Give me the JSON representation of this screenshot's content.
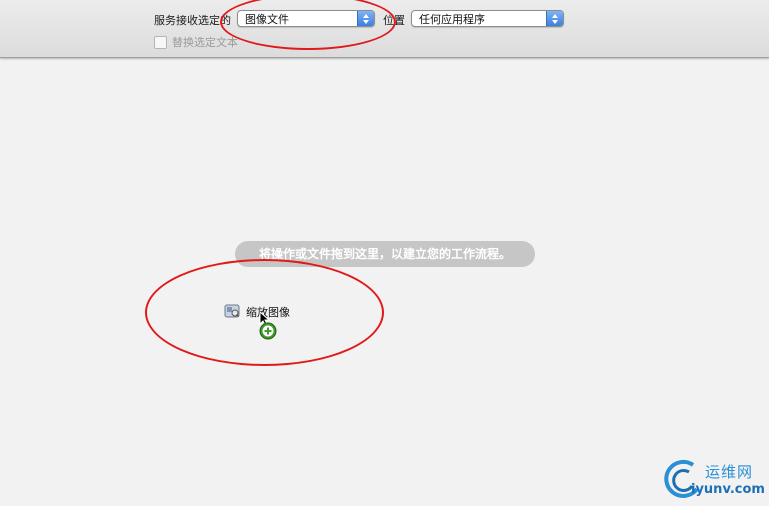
{
  "toolbar": {
    "service_receives_label": "服务接收选定的",
    "input_type_value": "图像文件",
    "location_label": "位置",
    "location_value": "任何应用程序",
    "replace_selected_label": "替换选定文本"
  },
  "workflow": {
    "hint": "将操作或文件拖到这里，以建立您的工作流程。",
    "dragged_action_label": "缩放图像"
  },
  "watermark": {
    "name_cn": "运维网",
    "domain": "iyunv.com"
  },
  "colors": {
    "annotation_red": "#e01a1a",
    "popup_accent": "#3c7fe0",
    "add_badge_green": "#3f9a2a"
  },
  "icons": {
    "input_type_popup": "chevron-updown-icon",
    "location_popup": "chevron-updown-icon",
    "dragged_action": "automator-action-icon",
    "cursor": "arrow-cursor-icon",
    "add_badge": "plus-circle-icon"
  }
}
